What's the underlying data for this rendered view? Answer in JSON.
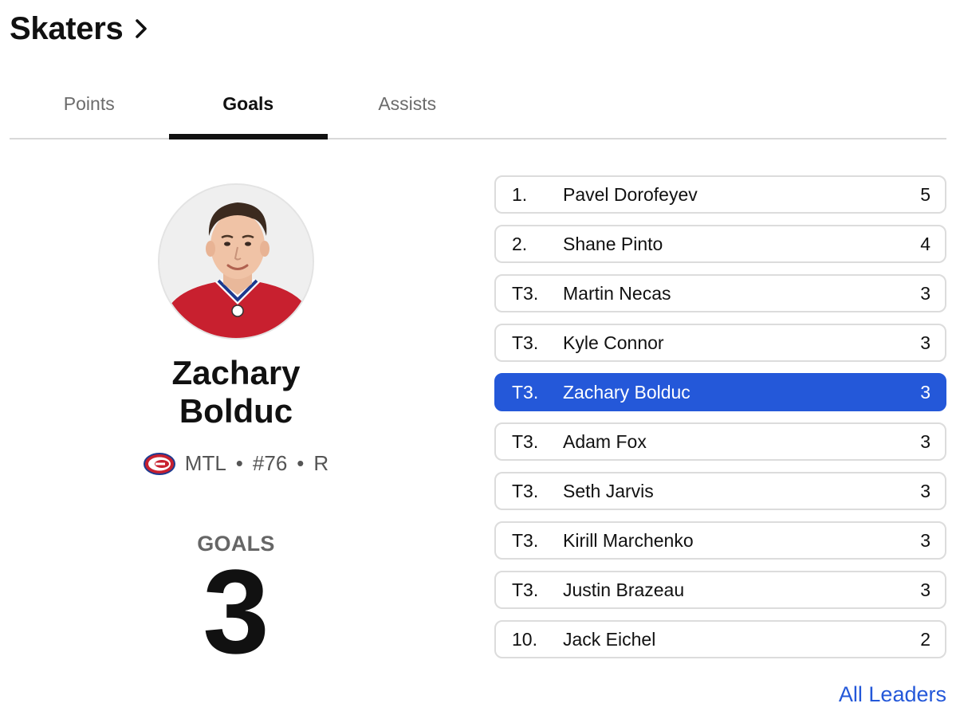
{
  "header": {
    "title": "Skaters",
    "chevron_icon": "chevron-right-icon"
  },
  "tabs": [
    {
      "label": "Points",
      "active": false
    },
    {
      "label": "Goals",
      "active": true
    },
    {
      "label": "Assists",
      "active": false
    }
  ],
  "featured_player": {
    "name_line1": "Zachary",
    "name_line2": "Bolduc",
    "team": "MTL",
    "number": "#76",
    "position": "R",
    "separator": "•",
    "stat_label": "GOALS",
    "stat_value": "3",
    "team_logo_icon": "canadiens-logo-icon",
    "colors": {
      "jersey_red": "#c8202f",
      "jersey_blue": "#1d3a8f"
    }
  },
  "leaders": [
    {
      "rank": "1.",
      "name": "Pavel Dorofeyev",
      "value": "5",
      "highlighted": false
    },
    {
      "rank": "2.",
      "name": "Shane Pinto",
      "value": "4",
      "highlighted": false
    },
    {
      "rank": "T3.",
      "name": "Martin Necas",
      "value": "3",
      "highlighted": false
    },
    {
      "rank": "T3.",
      "name": "Kyle Connor",
      "value": "3",
      "highlighted": false
    },
    {
      "rank": "T3.",
      "name": "Zachary Bolduc",
      "value": "3",
      "highlighted": true
    },
    {
      "rank": "T3.",
      "name": "Adam Fox",
      "value": "3",
      "highlighted": false
    },
    {
      "rank": "T3.",
      "name": "Seth Jarvis",
      "value": "3",
      "highlighted": false
    },
    {
      "rank": "T3.",
      "name": "Kirill Marchenko",
      "value": "3",
      "highlighted": false
    },
    {
      "rank": "T3.",
      "name": "Justin Brazeau",
      "value": "3",
      "highlighted": false
    },
    {
      "rank": "10.",
      "name": "Jack Eichel",
      "value": "2",
      "highlighted": false
    }
  ],
  "all_leaders_link": "All Leaders",
  "colors": {
    "accent": "#2458d9",
    "text": "#111111",
    "muted": "#6b6b6b",
    "border": "#dcdcdc"
  }
}
